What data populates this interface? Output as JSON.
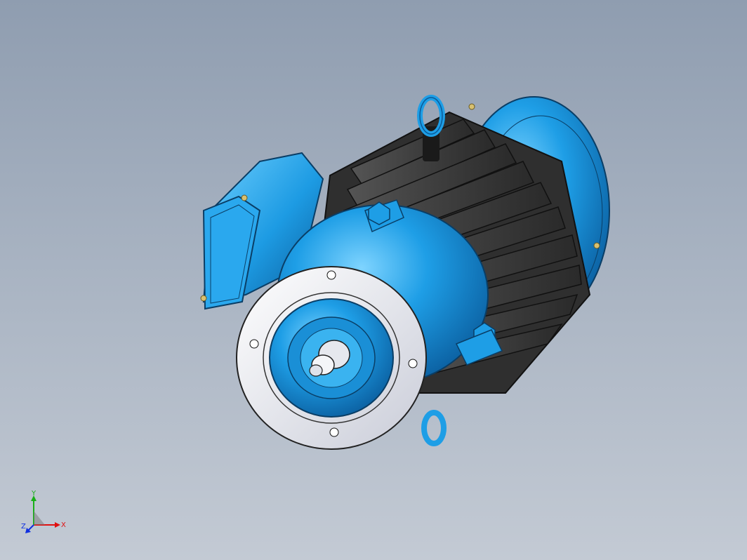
{
  "viewport": {
    "background_top": "#8f9db0",
    "background_bottom": "#c3cad4"
  },
  "model": {
    "name": "electric-motor",
    "body_color": "#1e9ee6",
    "fin_color": "#3a3a3a",
    "flange_color": "#e8eaf2"
  },
  "triad": {
    "x_label": "X",
    "y_label": "Y",
    "z_label": "Z",
    "x_color": "#e01010",
    "y_color": "#18b018",
    "z_color": "#1030e0"
  }
}
